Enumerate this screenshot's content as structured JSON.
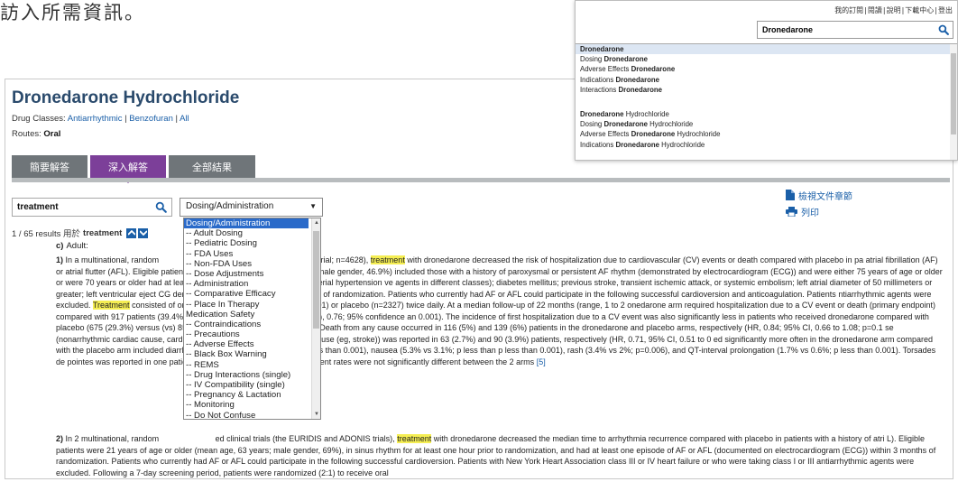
{
  "intro_text": "訪入所需資訊。",
  "header": {
    "drug_title": "Dronedarone Hydrochloride",
    "drug_classes_label": "Drug Classes:",
    "drug_classes": [
      "Antiarrhythmic",
      "Benzofuran",
      "All"
    ],
    "routes_label": "Routes:",
    "routes_value": "Oral"
  },
  "tabs": [
    {
      "label": "簡要解答",
      "active": false
    },
    {
      "label": "深入解答",
      "active": true
    },
    {
      "label": "全部結果",
      "active": false
    }
  ],
  "search": {
    "value": "treatment",
    "icon": "search-icon"
  },
  "section_select": {
    "selected": "Dosing/Administration",
    "options": [
      "Dosing/Administration",
      "-- Adult Dosing",
      "-- Pediatric Dosing",
      "-- FDA Uses",
      "-- Non-FDA Uses",
      "-- Dose Adjustments",
      "-- Administration",
      "-- Comparative Efficacy",
      "-- Place In Therapy",
      "Medication Safety",
      "-- Contraindications",
      "-- Precautions",
      "-- Adverse Effects",
      "-- Black Box Warning",
      "-- REMS",
      "-- Drug Interactions (single)",
      "-- IV Compatibility (single)",
      "-- Pregnancy & Lactation",
      "-- Monitoring",
      "-- Do Not Confuse"
    ]
  },
  "side_links": {
    "view_chapter": "檢視文件章節",
    "print": "列印"
  },
  "results": {
    "count_text": "1 / 65 results 用於",
    "term": "treatment"
  },
  "content": {
    "subheading_letter": "c)",
    "subheading_text": "Adult:",
    "p1_number": "1)",
    "p1_seg1": "In a multinational, random",
    "p1_seg2": "ed clinical trial (the ATHENA trial; n=4628),",
    "p1_hl1": "treatment",
    "p1_seg3": "with dronedarone decreased the risk of hospitalization due to cardiovascular (CV) events or death compared with placebo in pa",
    "p1_seg4": "atrial fibrillation (AF) or atrial flutter (AFL). Eligible patients (mean age, 71.6 +/- 9 years (yr); female gender, 46.9%) included those with a history of paroxysmal or persistent AF",
    "p1_seg5": "rhythm (demonstrated by electrocardiogram (ECG)) and were either 75 years of age or older or were 70 years or older had at least one of the following risk factors: arterial hypertension",
    "p1_seg6": "ve agents in different classes); diabetes mellitus; previous stroke, transient ischemic attack, or systemic embolism; left atrial diameter of 50 millimeters or greater; left ventricular eject",
    "p1_seg7": "CG demonstrating AF or AFL within 6 months of randomization. Patients who currently had AF or AFL could participate in the following successful cardioversion and anticoagulation. Patients",
    "p1_seg8": "ntiarrhythmic agents were excluded.",
    "p1_hl2": "Treatment",
    "p1_seg9": "consisted of oral dronedarone 400 milligrams (n=2301) or placebo (n=2327) twice daily. At a median follow-up of 22 months (range, 1 to 2",
    "p1_seg10": "onedarone arm required hospitalization due to a CV event or death (primary endpoint) compared with 917 patients (39.4%) in the placebo arm (hazard ratio (HR), 0.76; 95% confidence",
    "p1_seg11": "an 0.001). The incidence of first hospitalization due to a CV event was also significantly less in patients who received dronedarone compared with placebo (675 (29.3%) versus (vs) 859 (36.",
    "p1_seg12": "67 to 0.82; p less than 0.001). Death from any cause occurred in 116 (5%) and 139 (6%) patients in the dronedarone and placebo arms, respectively (HR, 0.84; 95% CI, 0.66 to 1.08; p=0.1",
    "p1_seg13": "se (nonarrhythmic cardiac cause, cardiac arrhythmia, noncardiac vascular cause (eg, stroke)) was reported in 63 (2.7%) and 90 (3.9%) patients, respectively (HR, 0.71, 95% CI, 0.51 to 0",
    "p1_seg14": "ed significantly more often in the dronedarone arm compared with the placebo arm included diarrhea (9.7% vs 6.2%, respectively; p less than 0.001), nausea (5.3% vs 3.1%; p less than",
    "p1_seg15": "p less than 0.001), rash (3.4% vs 2%; p=0.006), and QT-interval prolongation (1.7% vs 0.6%; p less than 0.001). Torsades de pointes was reported in one patient who received droned",
    "p1_seg16": "d adverse event rates were not significantly different between the 2 arms",
    "p1_ref": "[5]",
    "p2_number": "2)",
    "p2_seg1": "In 2 multinational, random",
    "p2_seg2": "ed clinical trials (the EURIDIS and ADONIS trials),",
    "p2_hl1": "treatment",
    "p2_seg3": "with dronedarone decreased the median time to arrhythmia recurrence compared with placebo in patients with a history of atri",
    "p2_seg4": "L). Eligible patients were 21 years of age or older (mean age, 63 years; male gender, 69%), in sinus rhythm for at least one hour prior to randomization, and had at least one episode of AF or AFL (documented on electrocardiogram (ECG)) within 3 months of randomization. Patients who currently had AF or AFL could participate in the following successful cardioversion. Patients with New York Heart Association class III or IV heart failure or who were taking class I or III antiarrhythmic agents were excluded. Following a 7-day screening period, patients were randomized (2:1) to receive oral"
  },
  "overlay": {
    "top_links": [
      "我的訂閱",
      "閱讀",
      "說明",
      "下載中心",
      "登出"
    ],
    "search_value": "Dronedarone",
    "autocomplete": [
      {
        "pre": "",
        "bold": "Dronedarone",
        "post": ""
      },
      {
        "pre": "Dosing ",
        "bold": "Dronedarone",
        "post": ""
      },
      {
        "pre": "Adverse Effects ",
        "bold": "Dronedarone",
        "post": ""
      },
      {
        "pre": "Indications ",
        "bold": "Dronedarone",
        "post": ""
      },
      {
        "pre": "Interactions ",
        "bold": "Dronedarone",
        "post": ""
      },
      {
        "pre": "",
        "bold": "",
        "post": ""
      },
      {
        "pre": "",
        "bold": "Dronedarone",
        "post": " Hydrochloride"
      },
      {
        "pre": "Dosing ",
        "bold": "Dronedarone",
        "post": " Hydrochloride"
      },
      {
        "pre": "Adverse Effects ",
        "bold": "Dronedarone",
        "post": " Hydrochloride"
      },
      {
        "pre": "Indications ",
        "bold": "Dronedarone",
        "post": " Hydrochloride"
      }
    ]
  },
  "colors": {
    "title": "#2a4a6c",
    "tab_active": "#7c3f99",
    "tab_inactive": "#6f7579",
    "link": "#1a5fa8",
    "highlight": "#f5ee53",
    "selected_option": "#2a6ac9"
  }
}
